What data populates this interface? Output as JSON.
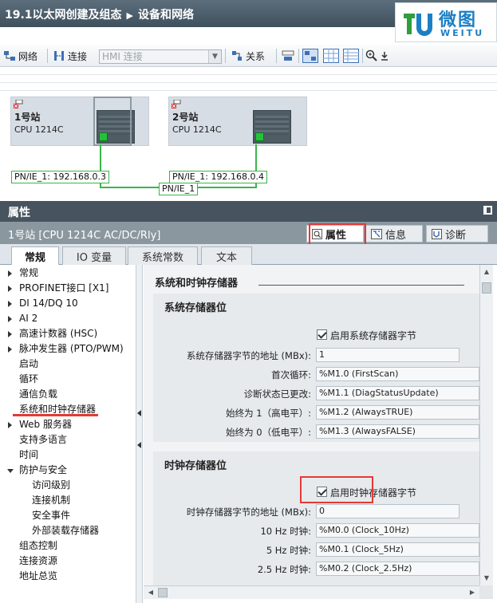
{
  "title": {
    "project": "19.1以太网创建及组态",
    "view": "设备和网络"
  },
  "logo": {
    "cn": "微图",
    "en": "WEITU",
    "mark": "TU"
  },
  "toolbar": {
    "network": "网络",
    "connection": "连接",
    "hmi_connection": "HMI 连接",
    "relation": "关系"
  },
  "network": {
    "stations": [
      {
        "name": "1号站",
        "cpu": "CPU 1214C",
        "pn": "PN/IE_1: 192.168.0.3"
      },
      {
        "name": "2号站",
        "cpu": "CPU 1214C",
        "pn": "PN/IE_1: 192.168.0.4"
      }
    ],
    "subnet": "PN/IE_1"
  },
  "properties": {
    "title": "属性",
    "device": "1号站 [CPU 1214C AC/DC/Rly]",
    "right_tabs": [
      "属性",
      "信息",
      "诊断"
    ],
    "tabs": [
      "常规",
      "IO 变量",
      "系统常数",
      "文本"
    ]
  },
  "nav": {
    "items": [
      "常规",
      "PROFINET接口 [X1]",
      "DI 14/DQ 10",
      "AI 2",
      "高速计数器 (HSC)",
      "脉冲发生器 (PTO/PWM)",
      "启动",
      "循环",
      "通信负载",
      "系统和时钟存储器",
      "Web 服务器",
      "支持多语言",
      "时间",
      "防护与安全",
      "访问级别",
      "连接机制",
      "安全事件",
      "外部装载存储器",
      "组态控制",
      "连接资源",
      "地址总览"
    ]
  },
  "content": {
    "section_title": "系统和时钟存储器",
    "system": {
      "title": "系统存储器位",
      "enable": "启用系统存储器字节",
      "fields": [
        {
          "label": "系统存储器字节的地址 (MBx):",
          "value": "1"
        },
        {
          "label": "首次循环:",
          "value": "%M1.0 (FirstScan)"
        },
        {
          "label": "诊断状态已更改:",
          "value": "%M1.1 (DiagStatusUpdate)"
        },
        {
          "label": "始终为 1（高电平）:",
          "value": "%M1.2 (AlwaysTRUE)"
        },
        {
          "label": "始终为 0（低电平）:",
          "value": "%M1.3 (AlwaysFALSE)"
        }
      ]
    },
    "clock": {
      "title": "时钟存储器位",
      "enable": "启用时钟存储器字节",
      "fields": [
        {
          "label": "时钟存储器字节的地址 (MBx):",
          "value": "0"
        },
        {
          "label": "10 Hz 时钟:",
          "value": "%M0.0 (Clock_10Hz)"
        },
        {
          "label": "5 Hz 时钟:",
          "value": "%M0.1 (Clock_5Hz)"
        },
        {
          "label": "2.5 Hz 时钟:",
          "value": "%M0.2 (Clock_2.5Hz)"
        }
      ]
    }
  },
  "colors": {
    "accent_red": "#e53935",
    "network_green": "#39b54a",
    "header_dark": "#47545f"
  }
}
